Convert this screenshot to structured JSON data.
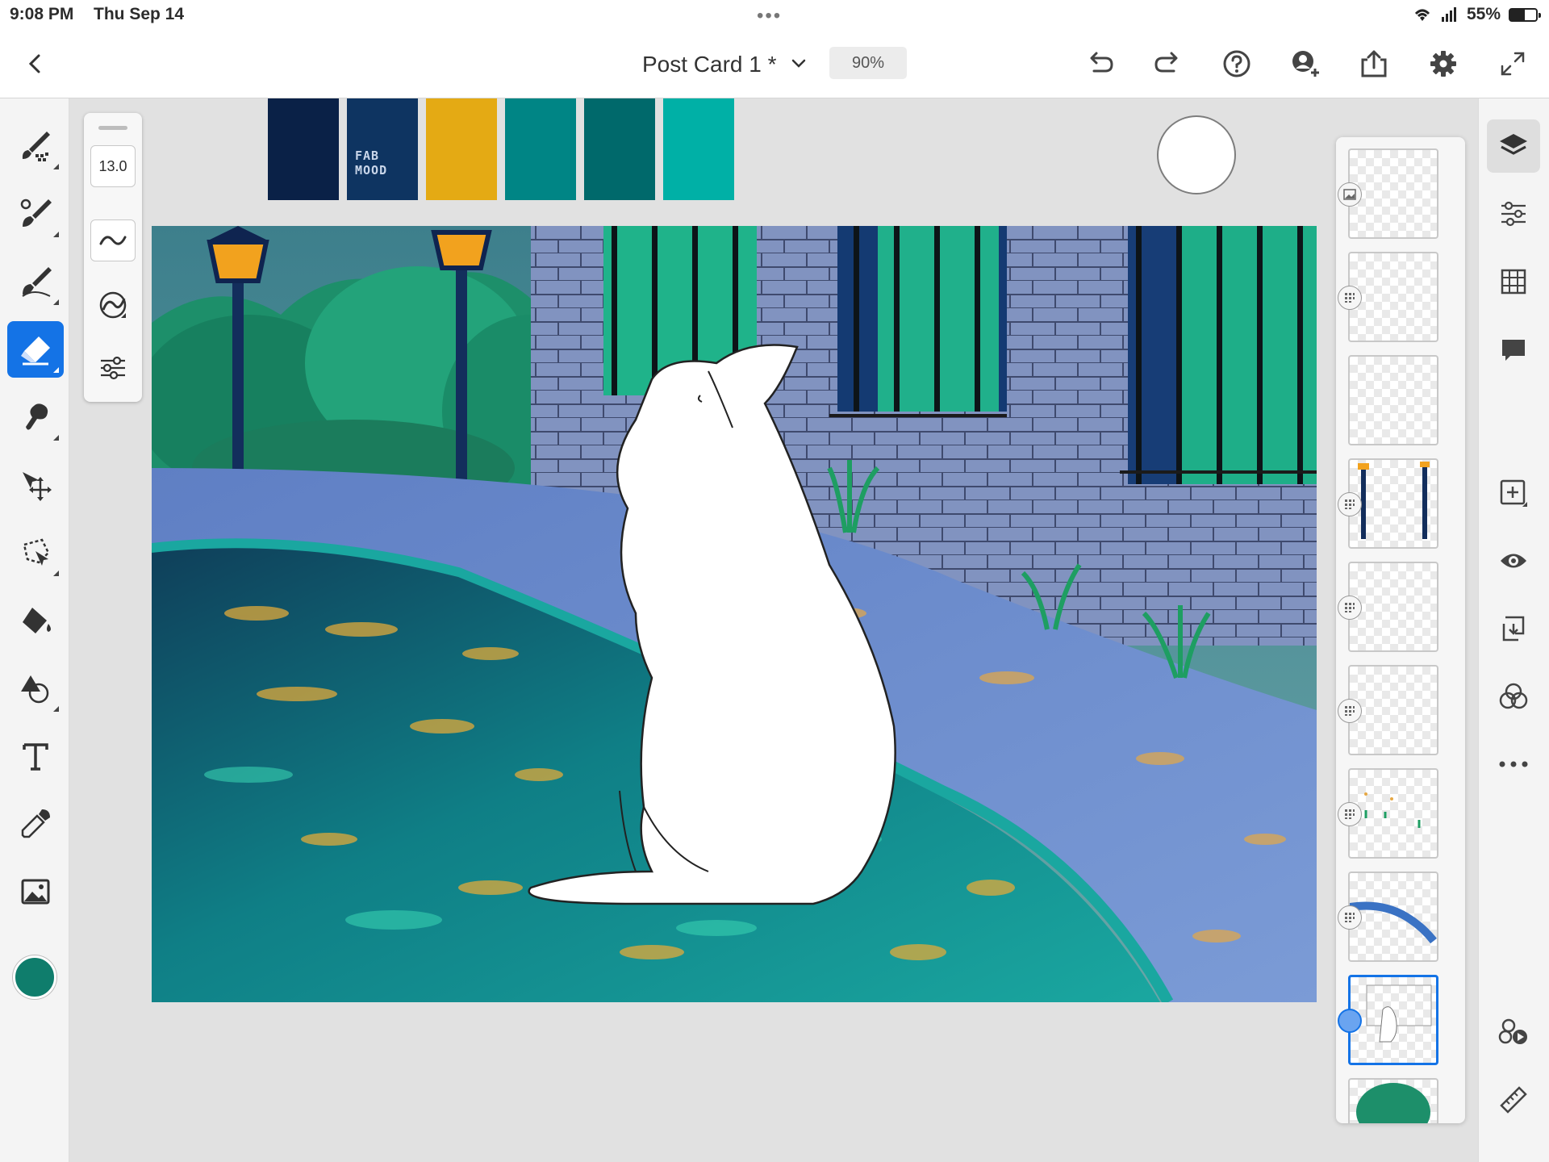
{
  "status_bar": {
    "time": "9:08 PM",
    "date": "Thu Sep 14",
    "dots": "•••",
    "battery": "55%",
    "battery_level": 0.55
  },
  "top_bar": {
    "title": "Post Card 1 *",
    "zoom": "90%"
  },
  "brush_panel": {
    "size": "13.0"
  },
  "palette": {
    "colors": [
      "#0a2147",
      "#0e3461",
      "#e4aa14",
      "#008585",
      "#00696b",
      "#00b0a6"
    ],
    "label_line1": "FAB",
    "label_line2": "MOOD"
  },
  "current_color": "#0f7d6c",
  "accent_color": "#1473e6",
  "left_tools": [
    "pixel-brush",
    "live-brush",
    "vector-brush",
    "eraser",
    "smudge",
    "transform",
    "selection",
    "fill",
    "liquify",
    "text",
    "eyedropper",
    "image-place"
  ],
  "right_tools": [
    "layers",
    "layer-properties",
    "grid",
    "comments",
    "add-layer",
    "visibility",
    "merge-down",
    "blend-mode",
    "more",
    "timelapse",
    "ruler"
  ],
  "layers": {
    "count": 10,
    "selected_index": 8
  }
}
